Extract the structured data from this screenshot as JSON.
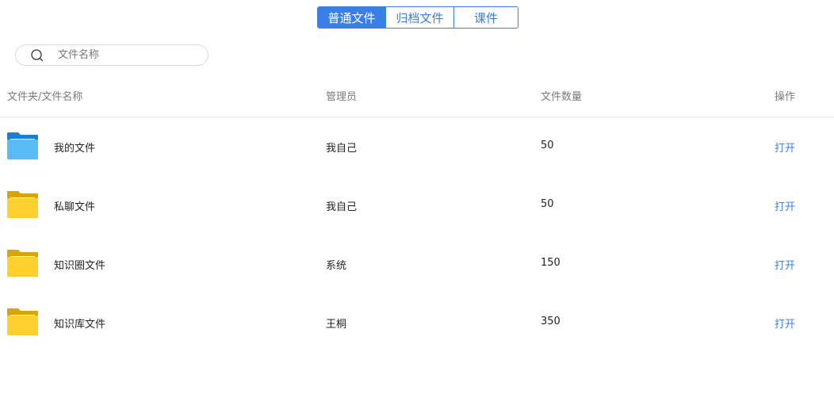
{
  "tabs": [
    {
      "label": "普通文件",
      "active": true
    },
    {
      "label": "归档文件",
      "active": false
    },
    {
      "label": "课件",
      "active": false
    }
  ],
  "search": {
    "placeholder": "文件名称",
    "icon": "search-icon"
  },
  "table": {
    "headers": {
      "name": "文件夹/文件名称",
      "admin": "管理员",
      "count": "文件数量",
      "operation": "操作"
    },
    "rows": [
      {
        "name": "我的文件",
        "admin": "我自己",
        "count": "50",
        "action": "打开",
        "folder_color": "#3a9be8",
        "folder_icon": "blue-folder-icon"
      },
      {
        "name": "私聊文件",
        "admin": "我自己",
        "count": "50",
        "action": "打开",
        "folder_color": "#f5c524",
        "folder_icon": "yellow-folder-icon"
      },
      {
        "name": "知识圈文件",
        "admin": "系统",
        "count": "150",
        "action": "打开",
        "folder_color": "#f5c524",
        "folder_icon": "yellow-folder-icon"
      },
      {
        "name": "知识库文件",
        "admin": "王桐",
        "count": "350",
        "action": "打开",
        "folder_color": "#f5c524",
        "folder_icon": "yellow-folder-icon"
      }
    ]
  },
  "colors": {
    "accent": "#3a7ee8",
    "header_text": "#7a7a7a",
    "divider": "#e6e6e6"
  }
}
